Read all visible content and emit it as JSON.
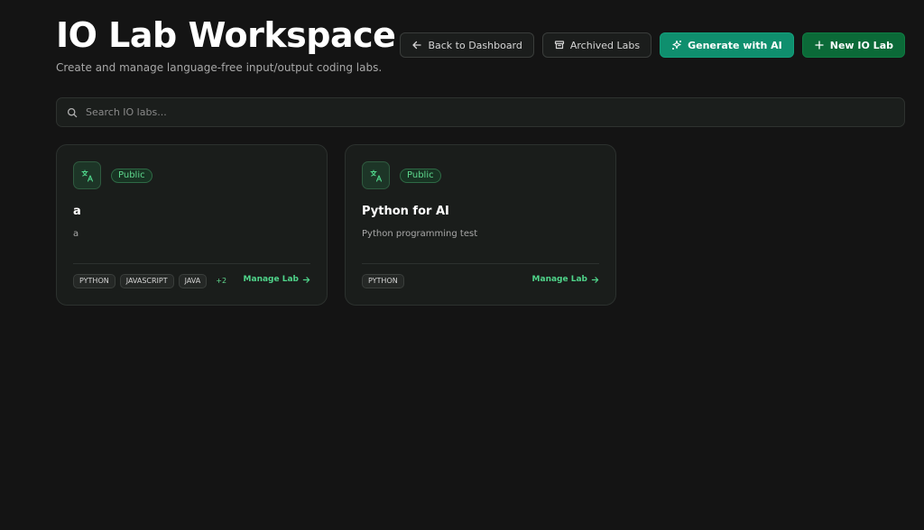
{
  "header": {
    "title": "IO Lab Workspace",
    "subtitle": "Create and manage language-free input/output coding labs."
  },
  "actions": {
    "back_label": "Back to Dashboard",
    "archived_label": "Archived Labs",
    "generate_label": "Generate with AI",
    "new_label": "New IO Lab"
  },
  "search": {
    "placeholder": "Search IO labs..."
  },
  "labs": [
    {
      "badge": "Public",
      "title": "a",
      "description": "a",
      "tags": [
        "PYTHON",
        "JAVASCRIPT",
        "JAVA"
      ],
      "more": "+2",
      "manage_label": "Manage Lab"
    },
    {
      "badge": "Public",
      "title": "Python for AI",
      "description": "Python programming test",
      "tags": [
        "PYTHON"
      ],
      "more": "",
      "manage_label": "Manage Lab"
    }
  ],
  "colors": {
    "background": "#141414",
    "accent_green": "#4fd48a",
    "teal_button": "#0f8f6e",
    "green_button": "#0b6a38"
  },
  "icons": {
    "back": "arrow-left-icon",
    "archived": "archive-box-icon",
    "generate": "sparkles-icon",
    "new": "plus-icon",
    "search": "search-icon",
    "lab": "translate-icon",
    "manage": "arrow-right-icon"
  }
}
